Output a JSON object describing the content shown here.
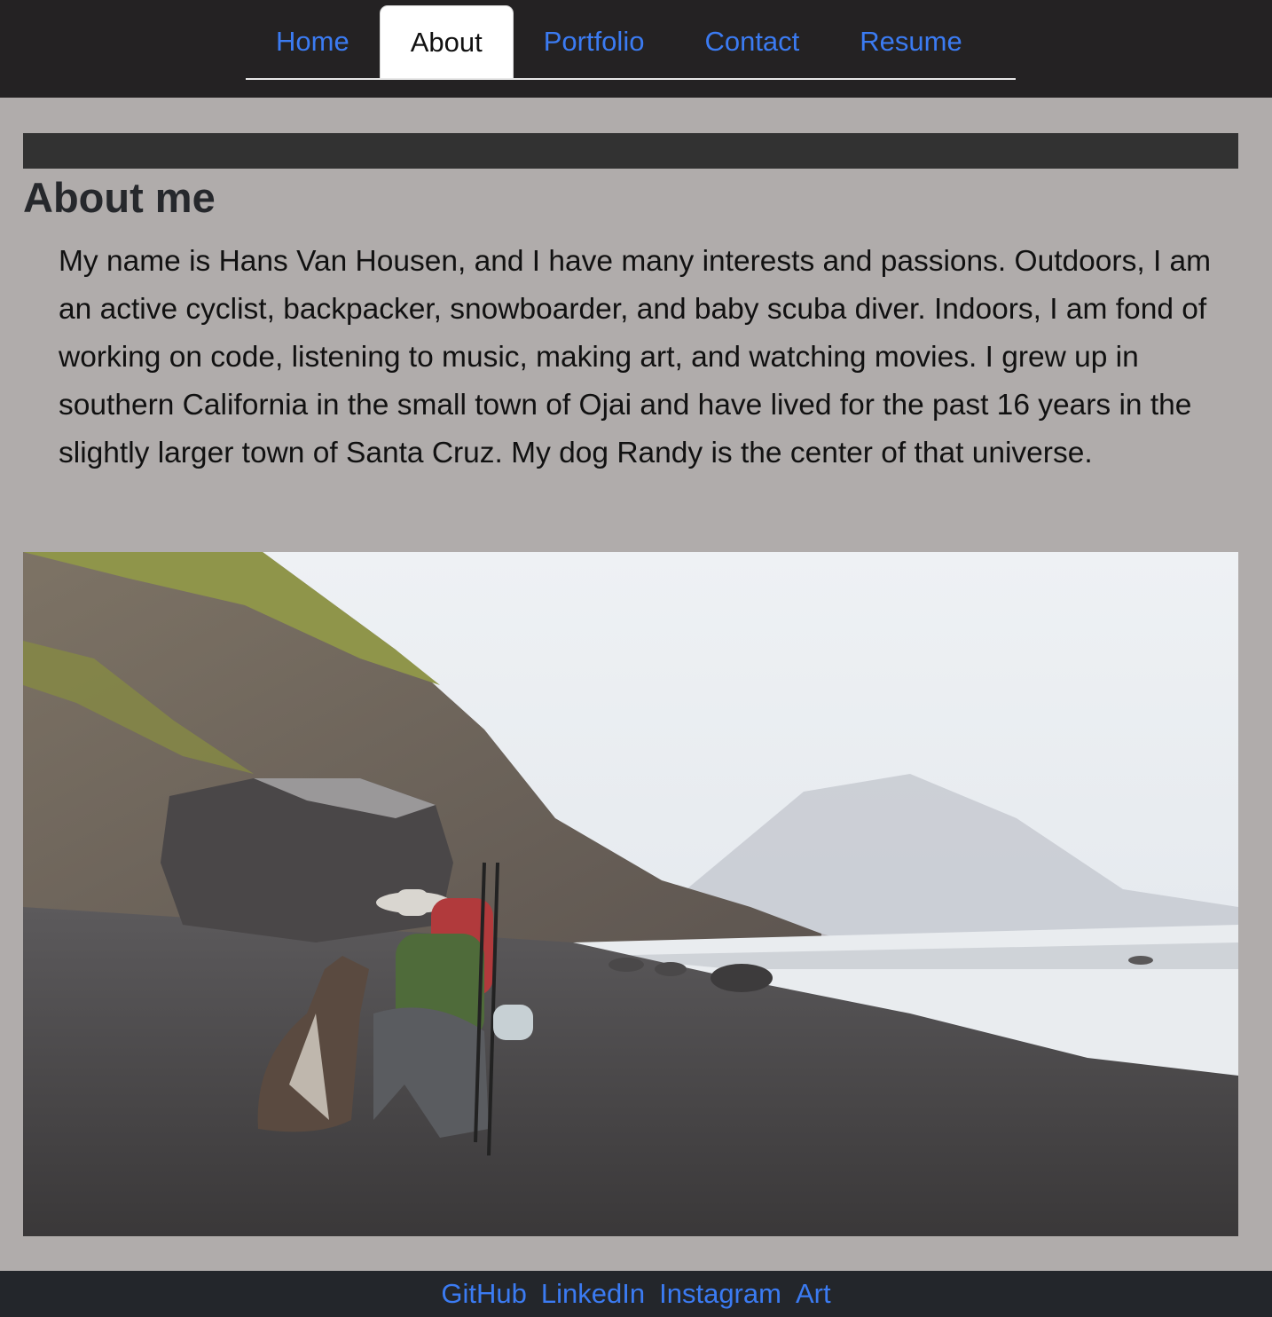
{
  "nav": {
    "items": [
      {
        "label": "Home",
        "active": false
      },
      {
        "label": "About",
        "active": true
      },
      {
        "label": "Portfolio",
        "active": false
      },
      {
        "label": "Contact",
        "active": false
      },
      {
        "label": "Resume",
        "active": false
      }
    ]
  },
  "main": {
    "heading": "About me",
    "bio": "My name is Hans Van Housen, and I have many interests and passions. Outdoors, I am an active cyclist, backpacker, snowboarder, and baby scuba diver. Indoors, I am fond of working on code, listening to music, making art, and watching movies. I grew up in southern California in the small town of Ojai and have lived for the past 16 years in the slightly larger town of Santa Cruz. My dog Randy is the center of that universe."
  },
  "footer": {
    "links": [
      "GitHub",
      "LinkedIn",
      "Instagram",
      "Art"
    ]
  },
  "colors": {
    "topbar": "#242223",
    "page_background": "#b0acab",
    "link": "#3b7bf2",
    "footer": "#23262b",
    "banner": "#323232"
  }
}
